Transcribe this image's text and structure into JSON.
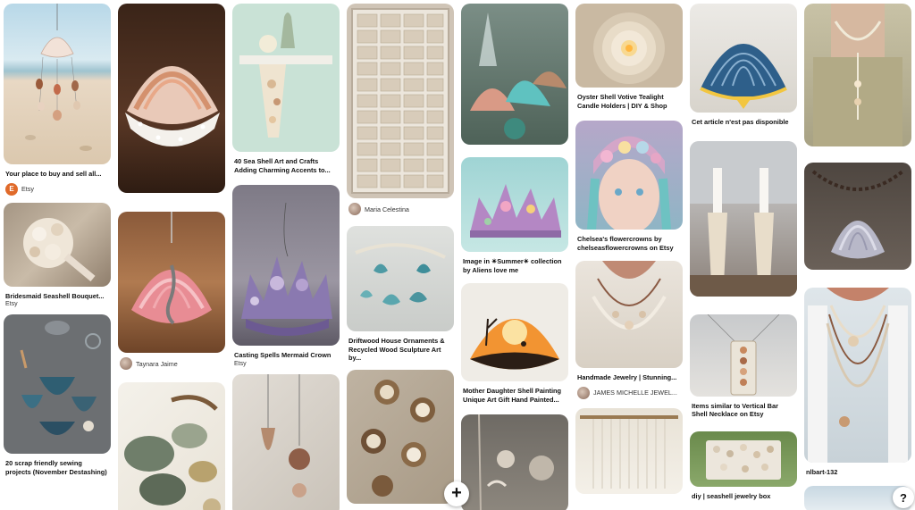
{
  "pins": [
    {
      "title": "Your place to buy and sell all...",
      "source": "Etsy",
      "source_initial": "E"
    },
    {
      "title": "Bridesmaid Seashell Bouquet...",
      "subtitle": "Etsy"
    },
    {
      "title": "20 scrap friendly sewing projects (November Destashing)"
    },
    {
      "title": "40 Sea Shell Art and Crafts Adding Charming Accents to..."
    },
    {
      "source": "Taynara Jaime"
    },
    {
      "title": "Casting Spells Mermaid Crown",
      "subtitle": "Etsy"
    },
    {
      "source": "Maria Celestina"
    },
    {
      "title": "Driftwood House Ornaments & Recycled Wood Sculpture Art by..."
    },
    {
      "title": "Image in ✴Summer✴ collection by Aliens love me"
    },
    {
      "title": "Mother Daughter Shell Painting Unique Art Gift Hand Painted..."
    },
    {
      "title": "Oyster Shell Votive Tealight Candle Holders | DIY & Shop"
    },
    {
      "title": "Chelsea's flowercrowns by chelseasflowercrowns on Etsy"
    },
    {
      "title": "Handmade Jewelry | Stunning...",
      "source": "JAMES MICHELLE JEWEL..."
    },
    {
      "title": "Cet article n'est pas disponible"
    },
    {
      "title": "Items similar to Vertical Bar Shell Necklace on Etsy"
    },
    {
      "title": "diy | seashell jewelry box"
    },
    {
      "title": "nlbart-132"
    }
  ],
  "controls": {
    "add_icon": "+",
    "help_icon": "?"
  },
  "colors": {
    "etsy_orange": "#e06a2a",
    "text": "#111111"
  }
}
